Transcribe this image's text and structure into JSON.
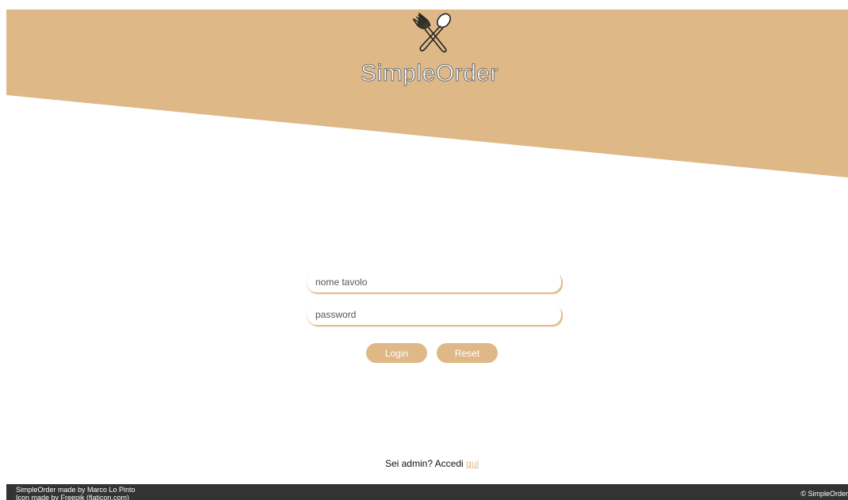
{
  "brand": {
    "title": "SimpleOrder",
    "logo_icon": "fork-spoon-icon",
    "accent_color": "#deb887",
    "footer_color": "#333333"
  },
  "login": {
    "table_name_placeholder": "nome tavolo",
    "password_placeholder": "password",
    "login_label": "Login",
    "reset_label": "Reset"
  },
  "admin": {
    "prompt": "Sei admin? Accedi ",
    "link_label": "qui"
  },
  "footer": {
    "credit_line_1": "SimpleOrder made by Marco Lo Pinto",
    "credit_line_2": "Icon made by Freepik (flaticon.com)",
    "copyright": "© SimpleOrder"
  }
}
